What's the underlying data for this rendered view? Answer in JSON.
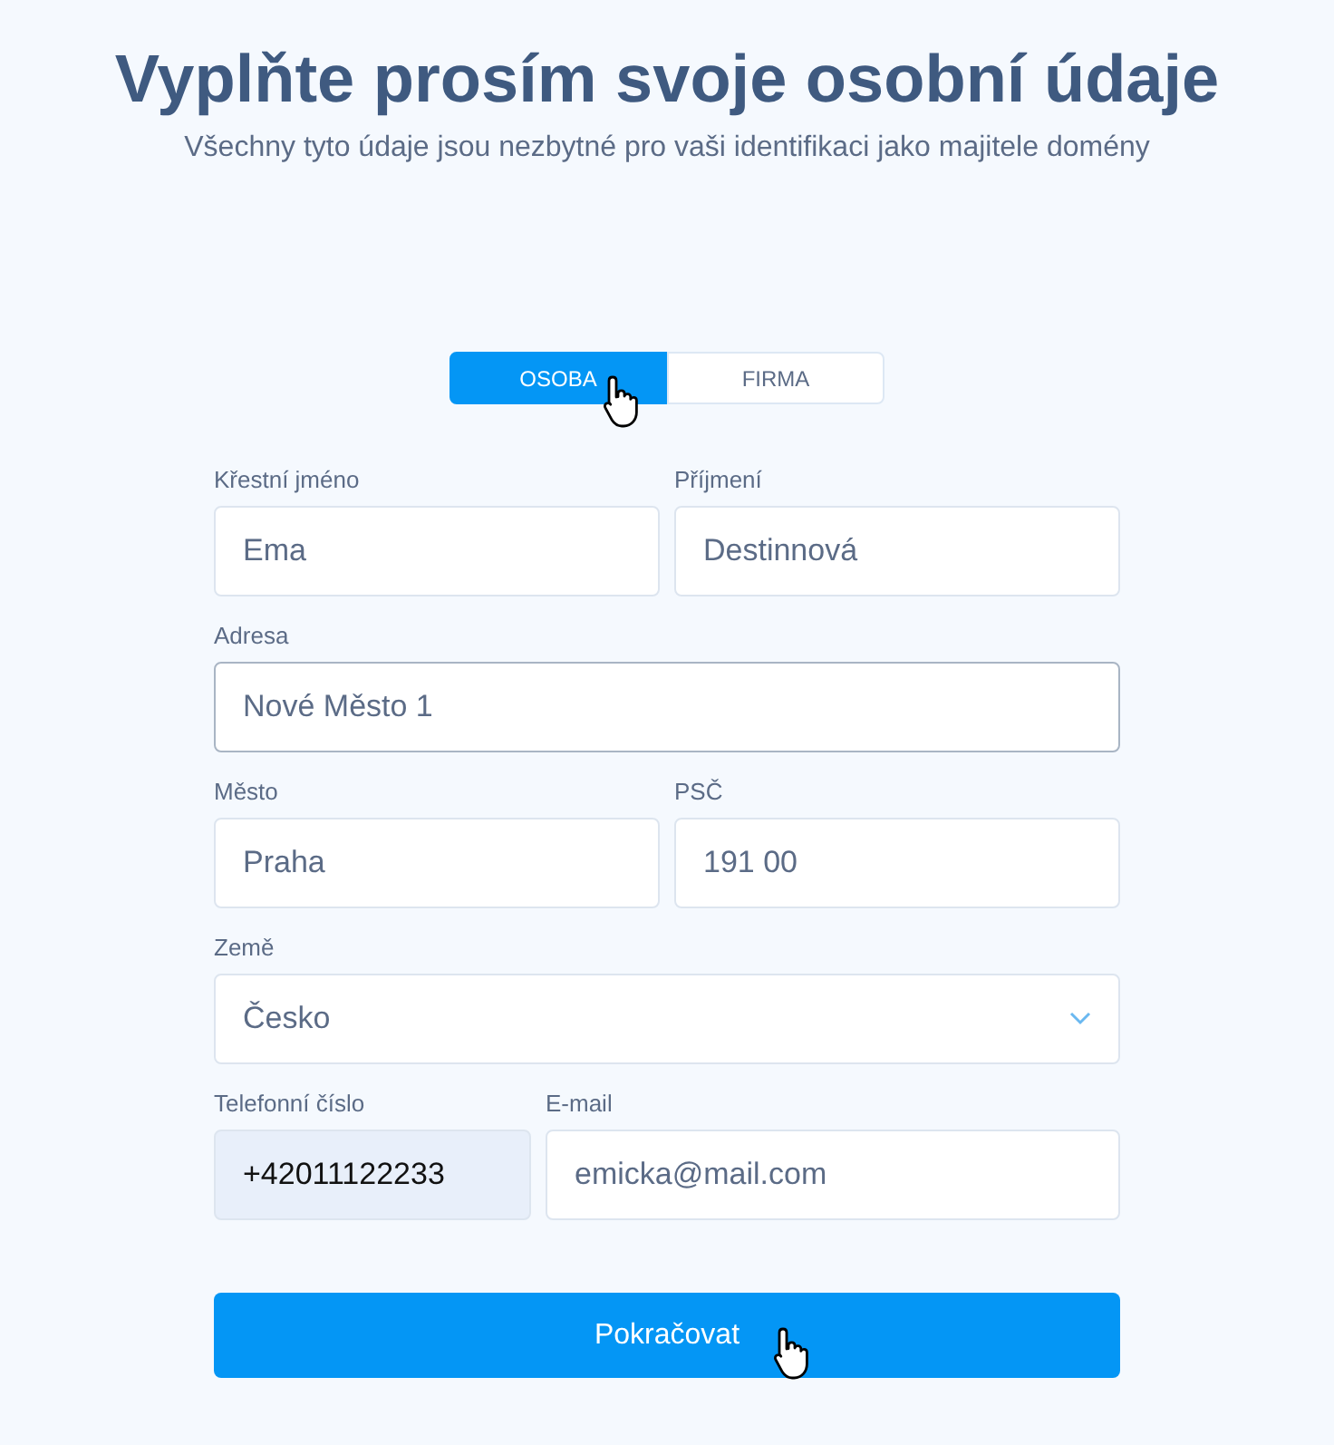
{
  "title": "Vyplňte prosím svoje osobní údaje",
  "subtitle": "Všechny tyto údaje jsou nezbytné pro vaši identifikaci jako majitele domény",
  "tabs": [
    {
      "label": "OSOBA",
      "selected": true
    },
    {
      "label": "FIRMA",
      "selected": false
    }
  ],
  "rows": [
    {
      "fields": [
        {
          "kind": "text",
          "label": "Křestní jméno",
          "value": "Ema",
          "focused": false
        },
        {
          "kind": "text",
          "label": "Příjmení",
          "value": "Destinnová",
          "focused": false
        }
      ]
    },
    {
      "fields": [
        {
          "kind": "text",
          "label": "Adresa",
          "value": "Nové Město 1",
          "focused": true
        }
      ]
    },
    {
      "fields": [
        {
          "kind": "text",
          "label": "Město",
          "value": "Praha",
          "focused": false
        },
        {
          "kind": "text",
          "label": "PSČ",
          "value": "191 00",
          "focused": false
        }
      ]
    },
    {
      "fields": [
        {
          "kind": "select",
          "label": "Země",
          "value": "Česko",
          "focused": false
        }
      ]
    },
    {
      "fields": [
        {
          "kind": "phone",
          "label": "Telefonní číslo",
          "value": "+42011122233",
          "focused": false
        },
        {
          "kind": "text",
          "label": "E-mail",
          "value": "emicka@mail.com",
          "focused": false
        }
      ]
    }
  ],
  "submit": "Pokračovat"
}
